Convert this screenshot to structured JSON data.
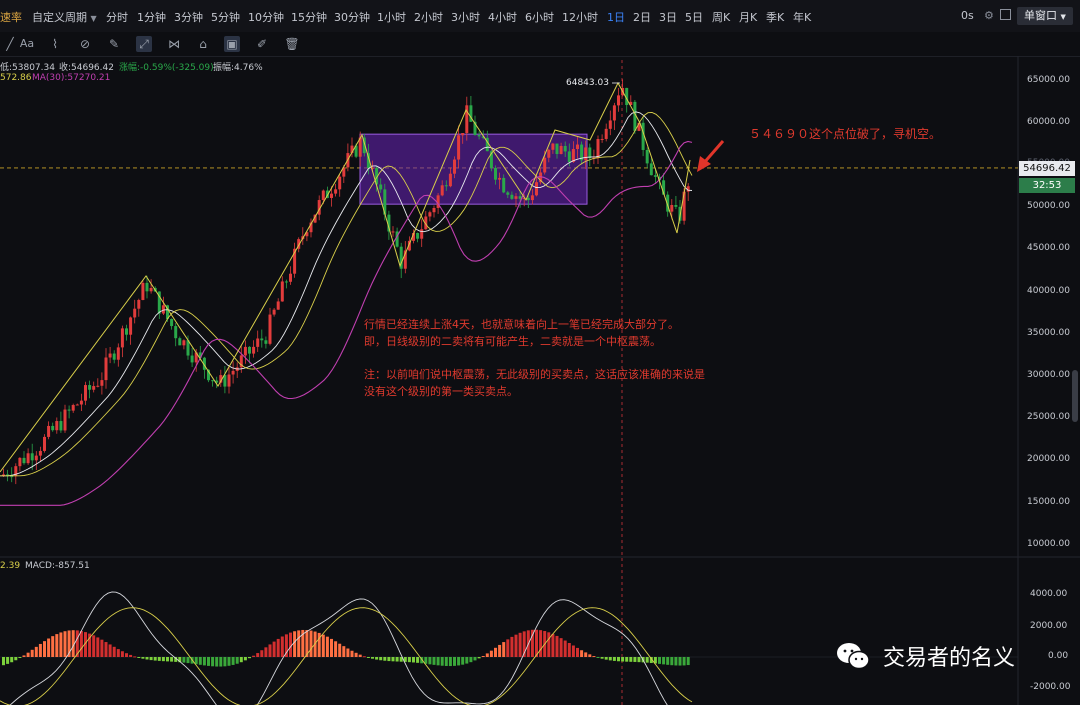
{
  "header": {
    "logo_text": "速率",
    "custom_period": "自定义周期",
    "timeframes": [
      "分时",
      "1分钟",
      "3分钟",
      "5分钟",
      "10分钟",
      "15分钟",
      "30分钟",
      "1小时",
      "2小时",
      "3小时",
      "4小时",
      "6小时",
      "12小时",
      "1日",
      "2日",
      "3日",
      "5日",
      "周K",
      "月K",
      "季K",
      "年K"
    ],
    "active_timeframe": "1日",
    "latency": "0s",
    "window_button": "单窗口"
  },
  "toolbar": {
    "icons": [
      "line-tool-icon",
      "text-tool-icon",
      "brush-icon",
      "parallel-tool-icon",
      "pencil-icon",
      "trend-tool-icon",
      "pattern-tool-icon",
      "lock-icon",
      "magnet-icon",
      "edit-icon",
      "trash-icon"
    ],
    "text_tool_label": "Aa"
  },
  "info": {
    "low": "低:53807.34",
    "close": "收:54696.42",
    "change": "涨幅:-0.59%(-325.09)",
    "amplitude": "振幅:4.76%",
    "ma_partial": "572.86",
    "ma30": "MA(30):57270.21",
    "macd_partial": "2.39",
    "macd": "MACD:-857.51"
  },
  "price_axis": {
    "ticks": [
      "65000.00",
      "60000.00",
      "55000.00",
      "50000.00",
      "45000.00",
      "40000.00",
      "35000.00",
      "30000.00",
      "25000.00",
      "20000.00",
      "15000.00",
      "10000.00"
    ],
    "current_price": "54696.42",
    "countdown": "32:53",
    "high_label": "64843.03"
  },
  "macd_axis": {
    "ticks": [
      "4000.00",
      "2000.00",
      "0.00",
      "-2000.00"
    ]
  },
  "annotations": {
    "right_note": "５４６９０这个点位破了，寻机空。",
    "main_note_1": "行情已经连续上涨4天，也就意味着向上一笔已经完成大部分了。",
    "main_note_2": "即，日线级别的二卖将有可能产生，二卖就是一个中枢震荡。",
    "main_note_3": "注：以前咱们说中枢震荡，无此级别的买卖点，这话应该准确的来说是",
    "main_note_4": "没有这个级别的第一类买卖点。"
  },
  "watermark": "交易者的名义",
  "colors": {
    "up": "#e23c3c",
    "down": "#2aa84a",
    "zone": "#6a22b8",
    "stroke": "#d9cf4a",
    "ma30": "#c03fb0",
    "accent": "#3b82f6",
    "countdown_bg": "#2c7d4a"
  }
}
